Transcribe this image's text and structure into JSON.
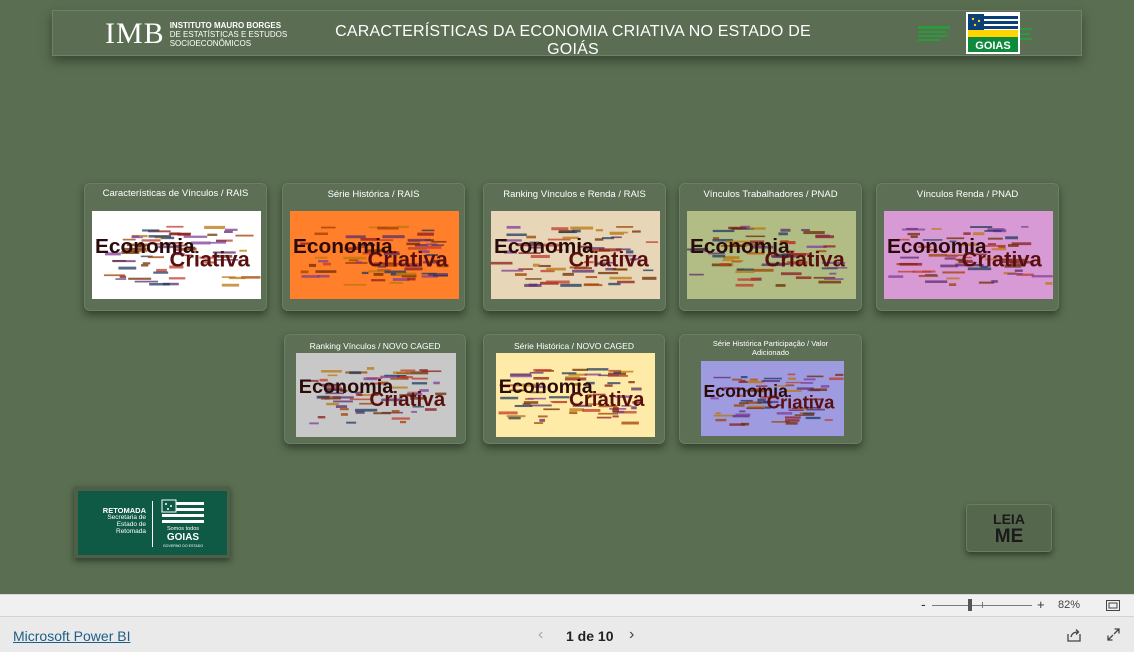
{
  "header": {
    "logo_mark": "IMB",
    "logo_line1": "INSTITUTO MAURO BORGES",
    "logo_line2": "DE ESTATÍSTICAS E ESTUDOS",
    "logo_line3": "SOCIOECONÔMICOS",
    "title": "CARACTERÍSTICAS DA ECONOMIA CRIATIVA NO ESTADO DE GOIÁS",
    "state_logo_text": "GOIAS"
  },
  "cards": [
    {
      "title": "Características de Vínculos / RAIS",
      "bg": "#ffffff"
    },
    {
      "title": "Série Histórica / RAIS",
      "bg": "#ff7f2a"
    },
    {
      "title": "Ranking Vínculos e Renda / RAIS",
      "bg": "#e8d6b9"
    },
    {
      "title": "Vínculos Trabalhadores / PNAD",
      "bg": "#b1bd85"
    },
    {
      "title": "Vínculos Renda / PNAD",
      "bg": "#d89ad4"
    },
    {
      "title": "Ranking Vínculos / NOVO CAGED",
      "bg": "#c8c8c8"
    },
    {
      "title": "Série Histórica / NOVO CAGED",
      "bg": "#fdeba7"
    },
    {
      "title": "Série Histórica Participação / Valor Adicionado",
      "bg": "#9e9be0"
    }
  ],
  "wordcloud": {
    "word1": "Economia",
    "word2": "Criativa"
  },
  "retomada": {
    "label_bold": "RETOMADA",
    "line1": "Secretaria de",
    "line2": "Estado de",
    "line3": "Retomada",
    "brand": "GOIAS",
    "brand_tag": "Somos todos",
    "gov": "GOVERNO DO ESTADO"
  },
  "leiame": {
    "line1": "LEIA",
    "line2": "ME"
  },
  "zoom": {
    "minus": "-",
    "plus": "+",
    "level": "82%"
  },
  "footer": {
    "powerbi_link": "Microsoft Power BI",
    "page_indicator": "1 de 10",
    "prev": "‹",
    "next": "›"
  },
  "colors": {
    "canvas": "#5a6e52",
    "link": "#1f5d86",
    "retomada_green": "#0f5a45"
  }
}
